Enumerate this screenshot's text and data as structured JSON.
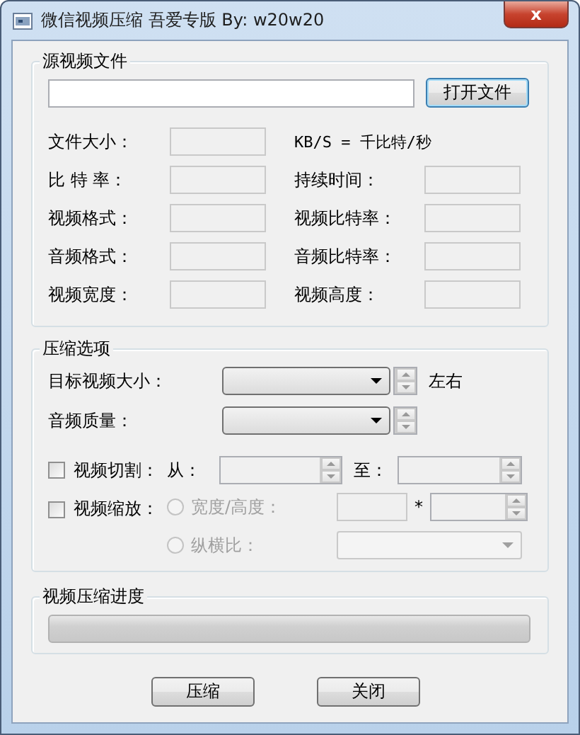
{
  "window": {
    "title": "微信视频压缩  吾爱专版 By: w20w20",
    "close": "x"
  },
  "source": {
    "title": "源视频文件",
    "open_button": "打开文件",
    "info_rows": [
      {
        "left": {
          "label": "文件大小："
        },
        "right": {
          "kind": "note",
          "label": "KB/S = 千比特/秒"
        }
      },
      {
        "left": {
          "label": "比 特 率："
        },
        "right": {
          "kind": "field",
          "label": "持续时间："
        }
      },
      {
        "left": {
          "label": "视频格式："
        },
        "right": {
          "kind": "field",
          "label": "视频比特率："
        }
      },
      {
        "left": {
          "label": "音频格式："
        },
        "right": {
          "kind": "field",
          "label": "音频比特率："
        }
      },
      {
        "left": {
          "label": "视频宽度："
        },
        "right": {
          "kind": "field",
          "label": "视频高度："
        }
      }
    ]
  },
  "compression": {
    "title": "压缩选项",
    "target_size": {
      "label": "目标视频大小：",
      "unit": "左右"
    },
    "audio_quality": {
      "label": "音频质量："
    },
    "cut": {
      "label": "视频切割：",
      "checked": false,
      "from_label": "从：",
      "to_label": "至："
    },
    "scale": {
      "label": "视频缩放：",
      "checked": false,
      "separator": "*",
      "options": [
        {
          "kind": "size",
          "label": "宽度/高度：",
          "selected": false,
          "disabled": true
        },
        {
          "kind": "ratio",
          "label": "纵横比：",
          "selected": false,
          "disabled": true
        }
      ]
    }
  },
  "progress": {
    "title": "视频压缩进度",
    "level": 0
  },
  "buttons": [
    "压缩",
    "关闭"
  ]
}
